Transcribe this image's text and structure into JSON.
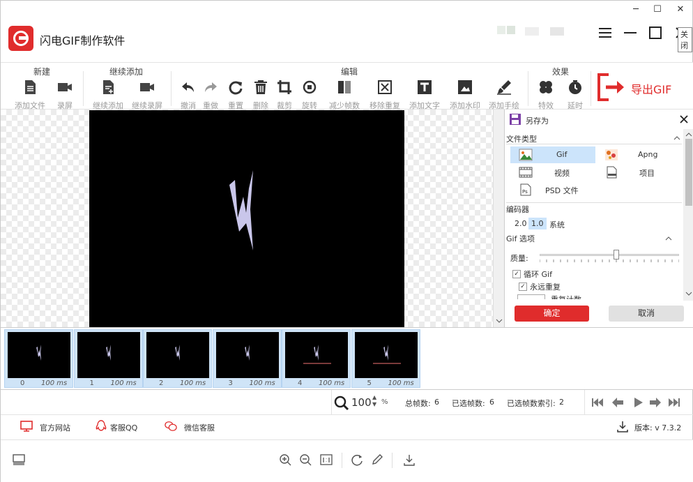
{
  "window": {
    "minimize": "─",
    "maximize": "☐",
    "close": "✕",
    "close_tooltip": "关闭"
  },
  "header": {
    "app_title": "闪电GIF制作软件",
    "icons": [
      "menu-icon",
      "minimize-icon",
      "maximize-icon",
      "close-icon"
    ]
  },
  "toolbar": {
    "groups": {
      "new": "新建",
      "continue": "继续添加",
      "edit": "编辑",
      "effects": "效果"
    },
    "buttons": {
      "add_file": "添加文件",
      "record": "录屏",
      "continue_add": "继续添加",
      "continue_record": "继续录屏",
      "undo": "撤消",
      "redo": "重做",
      "reset": "重置",
      "delete": "删除",
      "crop": "裁剪",
      "rotate": "旋转",
      "reduce_frames": "减少帧数",
      "remove_duplicates": "移除重复",
      "add_text": "添加文字",
      "add_watermark": "添加水印",
      "add_drawing": "添加手绘",
      "effects": "特效",
      "delay": "延时"
    },
    "export_label": "导出GIF"
  },
  "save_panel": {
    "title": "另存为",
    "file_type_label": "文件类型",
    "file_types": {
      "gif": "Gif",
      "apng": "Apng",
      "video": "视频",
      "project": "项目",
      "psd": "PSD 文件"
    },
    "encoder_label": "编码器",
    "encoders": {
      "v20": "2.0",
      "v10": "1.0",
      "system": "系统"
    },
    "gif_options_label": "Gif 选项",
    "quality_label": "质量:",
    "quality_value": 0.55,
    "loop_gif": "循环 Gif",
    "repeat_forever": "永远重复",
    "repeat_count": "重复计数",
    "ok": "确定",
    "cancel": "取消"
  },
  "frames": [
    {
      "index": "0",
      "delay": "100 ms"
    },
    {
      "index": "1",
      "delay": "100 ms"
    },
    {
      "index": "2",
      "delay": "100 ms"
    },
    {
      "index": "3",
      "delay": "100 ms"
    },
    {
      "index": "4",
      "delay": "100 ms"
    },
    {
      "index": "5",
      "delay": "100 ms"
    }
  ],
  "status": {
    "zoom": "100",
    "zoom_unit": "%",
    "total_frames_label": "总帧数:",
    "total_frames": "6",
    "selected_frames_label": "已选帧数:",
    "selected_frames": "6",
    "selected_index_label": "已选帧数索引:",
    "selected_index": "2"
  },
  "links": {
    "official_site": "官方网站",
    "qq_support": "客服QQ",
    "wechat_support": "微信客服",
    "version": "版本: v 7.3.2"
  },
  "colors": {
    "brand_red": "#e02c2c",
    "selection_blue": "#cce4fb"
  }
}
